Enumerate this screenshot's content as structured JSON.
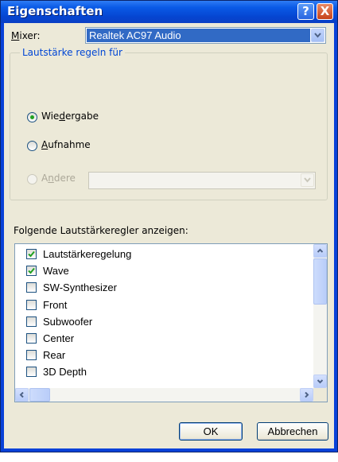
{
  "window": {
    "title": "Eigenschaften",
    "help_button": "?",
    "close_button": "X"
  },
  "mixer": {
    "label": "Mixer:",
    "value": "Realtek AC97 Audio"
  },
  "volume_group": {
    "title": "Lautstärke regeln für",
    "options": [
      {
        "label": "Wiedergabe",
        "selected": true,
        "enabled": true
      },
      {
        "label": "Aufnahme",
        "selected": false,
        "enabled": true
      },
      {
        "label": "Andere",
        "selected": false,
        "enabled": false
      }
    ],
    "other_device_value": ""
  },
  "controls": {
    "label": "Folgende Lautstärkeregler anzeigen:",
    "items": [
      {
        "label": "Lautstärkeregelung",
        "checked": true
      },
      {
        "label": "Wave",
        "checked": true
      },
      {
        "label": "SW-Synthesizer",
        "checked": false
      },
      {
        "label": "Front",
        "checked": false
      },
      {
        "label": "Subwoofer",
        "checked": false
      },
      {
        "label": "Center",
        "checked": false
      },
      {
        "label": "Rear",
        "checked": false
      },
      {
        "label": "3D Depth",
        "checked": false
      }
    ]
  },
  "buttons": {
    "ok": "OK",
    "cancel": "Abbrechen"
  },
  "colors": {
    "title_bar": "#0a5ae6",
    "selection": "#316ac5",
    "dialog": "#ece9d8",
    "check": "#21a121"
  }
}
